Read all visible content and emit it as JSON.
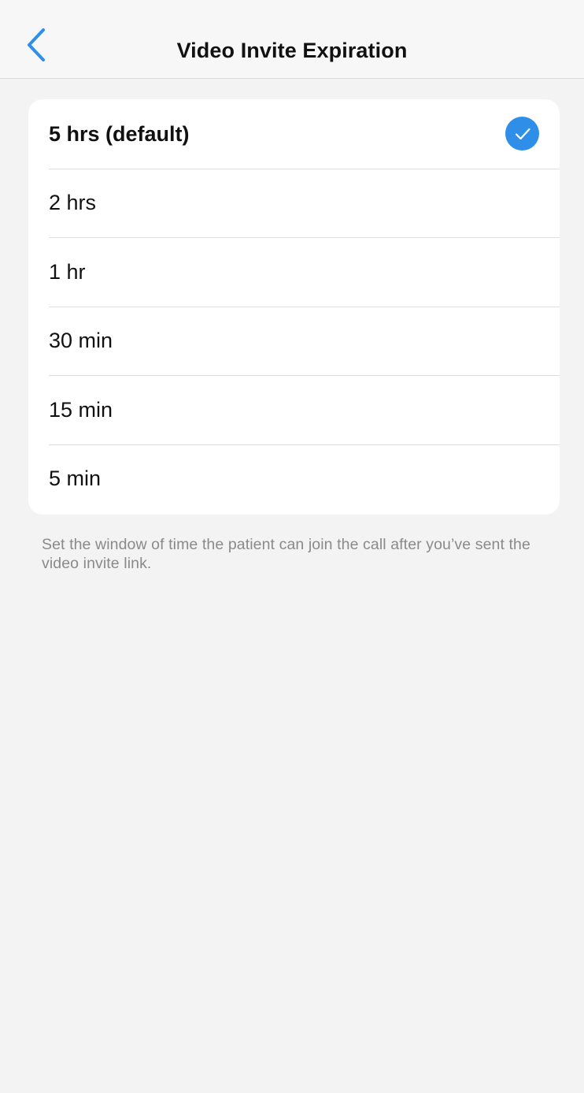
{
  "header": {
    "title": "Video Invite Expiration",
    "back_icon": "chevron-left-icon"
  },
  "colors": {
    "accent": "#2f8fe8",
    "background": "#f3f3f3",
    "card": "#ffffff",
    "muted_text": "#8a8a8a"
  },
  "options": {
    "selected_index": 0,
    "items": [
      {
        "label": "5 hrs (default)",
        "selected": true
      },
      {
        "label": "2 hrs",
        "selected": false
      },
      {
        "label": "1 hr",
        "selected": false
      },
      {
        "label": "30 min",
        "selected": false
      },
      {
        "label": "15 min",
        "selected": false
      },
      {
        "label": "5 min",
        "selected": false
      }
    ],
    "selected_icon": "checkmark-circle-icon"
  },
  "footer": {
    "note": "Set the window of time the patient can join the call after you’ve sent the video invite link."
  }
}
